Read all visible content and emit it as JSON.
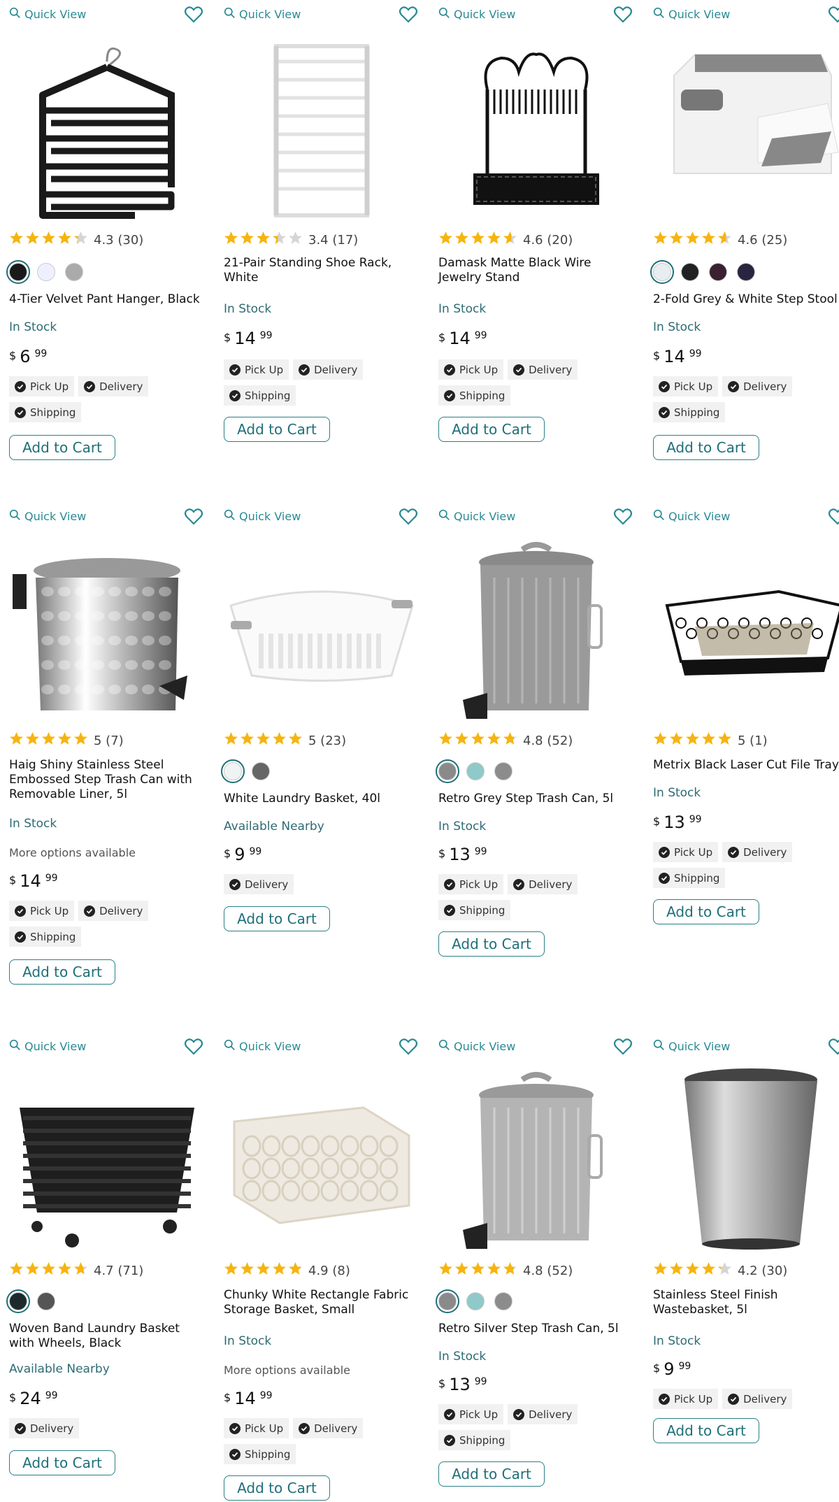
{
  "labels": {
    "quick_view": "Quick View",
    "add_to_cart": "Add to Cart",
    "more_options": "More options available"
  },
  "colors": {
    "accent": "#2a8a94",
    "star": "#f6b40e",
    "star_empty": "#d5d5d5"
  },
  "icons": {
    "quick_view": "search-icon",
    "wishlist": "heart-icon",
    "check": "check-circle-icon"
  },
  "products": [
    {
      "title": "4-Tier Velvet Pant Hanger, Black",
      "rating": 4.3,
      "rating_text": "4.3 (30)",
      "swatches": [
        "#1a1a1a",
        "#eef0ff",
        "#aaaaaa"
      ],
      "status": "In Stock",
      "more": "",
      "price": {
        "currency": "$",
        "dollars": "6",
        "cents": "99"
      },
      "chips": [
        "Pick Up",
        "Delivery",
        "Shipping"
      ],
      "img": "hanger"
    },
    {
      "title": "21-Pair Standing Shoe Rack, White",
      "rating": 3.4,
      "rating_text": "3.4 (17)",
      "swatches": [],
      "status": "In Stock",
      "more": "",
      "price": {
        "currency": "$",
        "dollars": "14",
        "cents": "99"
      },
      "chips": [
        "Pick Up",
        "Delivery",
        "Shipping"
      ],
      "img": "shoerack"
    },
    {
      "title": "Damask Matte Black Wire Jewelry Stand",
      "rating": 4.6,
      "rating_text": "4.6 (20)",
      "swatches": [],
      "status": "In Stock",
      "more": "",
      "price": {
        "currency": "$",
        "dollars": "14",
        "cents": "99"
      },
      "chips": [
        "Pick Up",
        "Delivery",
        "Shipping"
      ],
      "img": "jewelry"
    },
    {
      "title": "2-Fold Grey & White Step Stool",
      "rating": 4.6,
      "rating_text": "4.6 (25)",
      "swatches": [
        "#e8eef0",
        "#222222",
        "#3a2030",
        "#2a2440"
      ],
      "status": "In Stock",
      "more": "",
      "price": {
        "currency": "$",
        "dollars": "14",
        "cents": "99"
      },
      "chips": [
        "Pick Up",
        "Delivery",
        "Shipping"
      ],
      "img": "stool"
    },
    {
      "title": "Haig Shiny Stainless Steel Embossed Step Trash Can with Removable Liner, 5l",
      "rating": 5,
      "rating_text": "5 (7)",
      "swatches": [],
      "status": "In Stock",
      "more": "More options available",
      "price": {
        "currency": "$",
        "dollars": "14",
        "cents": "99"
      },
      "chips": [
        "Pick Up",
        "Delivery",
        "Shipping"
      ],
      "img": "hammered"
    },
    {
      "title": "White Laundry Basket, 40l",
      "rating": 5,
      "rating_text": "5 (23)",
      "swatches": [
        "#eef4f4",
        "#666666"
      ],
      "status": "Available Nearby",
      "more": "",
      "price": {
        "currency": "$",
        "dollars": "9",
        "cents": "99"
      },
      "chips": [
        "Delivery"
      ],
      "img": "laundry"
    },
    {
      "title": "Retro Grey Step Trash Can, 5l",
      "rating": 4.8,
      "rating_text": "4.8 (52)",
      "swatches": [
        "#8a8a8a",
        "#8fc9c9",
        "#8c8c8c"
      ],
      "status": "In Stock",
      "more": "",
      "price": {
        "currency": "$",
        "dollars": "13",
        "cents": "99"
      },
      "chips": [
        "Pick Up",
        "Delivery",
        "Shipping"
      ],
      "img": "greycan"
    },
    {
      "title": "Metrix Black Laser Cut File Tray",
      "rating": 5,
      "rating_text": "5 (1)",
      "swatches": [],
      "status": "In Stock",
      "more": "",
      "price": {
        "currency": "$",
        "dollars": "13",
        "cents": "99"
      },
      "chips": [
        "Pick Up",
        "Delivery",
        "Shipping"
      ],
      "img": "filetray"
    },
    {
      "title": "Woven Band Laundry Basket with Wheels, Black",
      "rating": 4.7,
      "rating_text": "4.7 (71)",
      "swatches": [
        "#1d2a2c",
        "#555555"
      ],
      "status": "Available Nearby",
      "more": "",
      "price": {
        "currency": "$",
        "dollars": "24",
        "cents": "99"
      },
      "chips": [
        "Delivery"
      ],
      "img": "wovenblack"
    },
    {
      "title": "Chunky White Rectangle Fabric Storage Basket, Small",
      "rating": 4.9,
      "rating_text": "4.9 (8)",
      "swatches": [],
      "status": "In Stock",
      "more": "More options available",
      "price": {
        "currency": "$",
        "dollars": "14",
        "cents": "99"
      },
      "chips": [
        "Pick Up",
        "Delivery",
        "Shipping"
      ],
      "img": "chunky"
    },
    {
      "title": "Retro Silver Step Trash Can, 5l",
      "rating": 4.8,
      "rating_text": "4.8 (52)",
      "swatches": [
        "#8a8a8a",
        "#8fc9c9",
        "#8c8c8c"
      ],
      "status": "In Stock",
      "more": "",
      "price": {
        "currency": "$",
        "dollars": "13",
        "cents": "99"
      },
      "chips": [
        "Pick Up",
        "Delivery",
        "Shipping"
      ],
      "img": "silvercan"
    },
    {
      "title": "Stainless Steel Finish Wastebasket, 5l",
      "rating": 4.2,
      "rating_text": "4.2 (30)",
      "swatches": [],
      "status": "In Stock",
      "more": "",
      "price": {
        "currency": "$",
        "dollars": "9",
        "cents": "99"
      },
      "chips": [
        "Pick Up",
        "Delivery"
      ],
      "img": "wastebasket"
    }
  ]
}
